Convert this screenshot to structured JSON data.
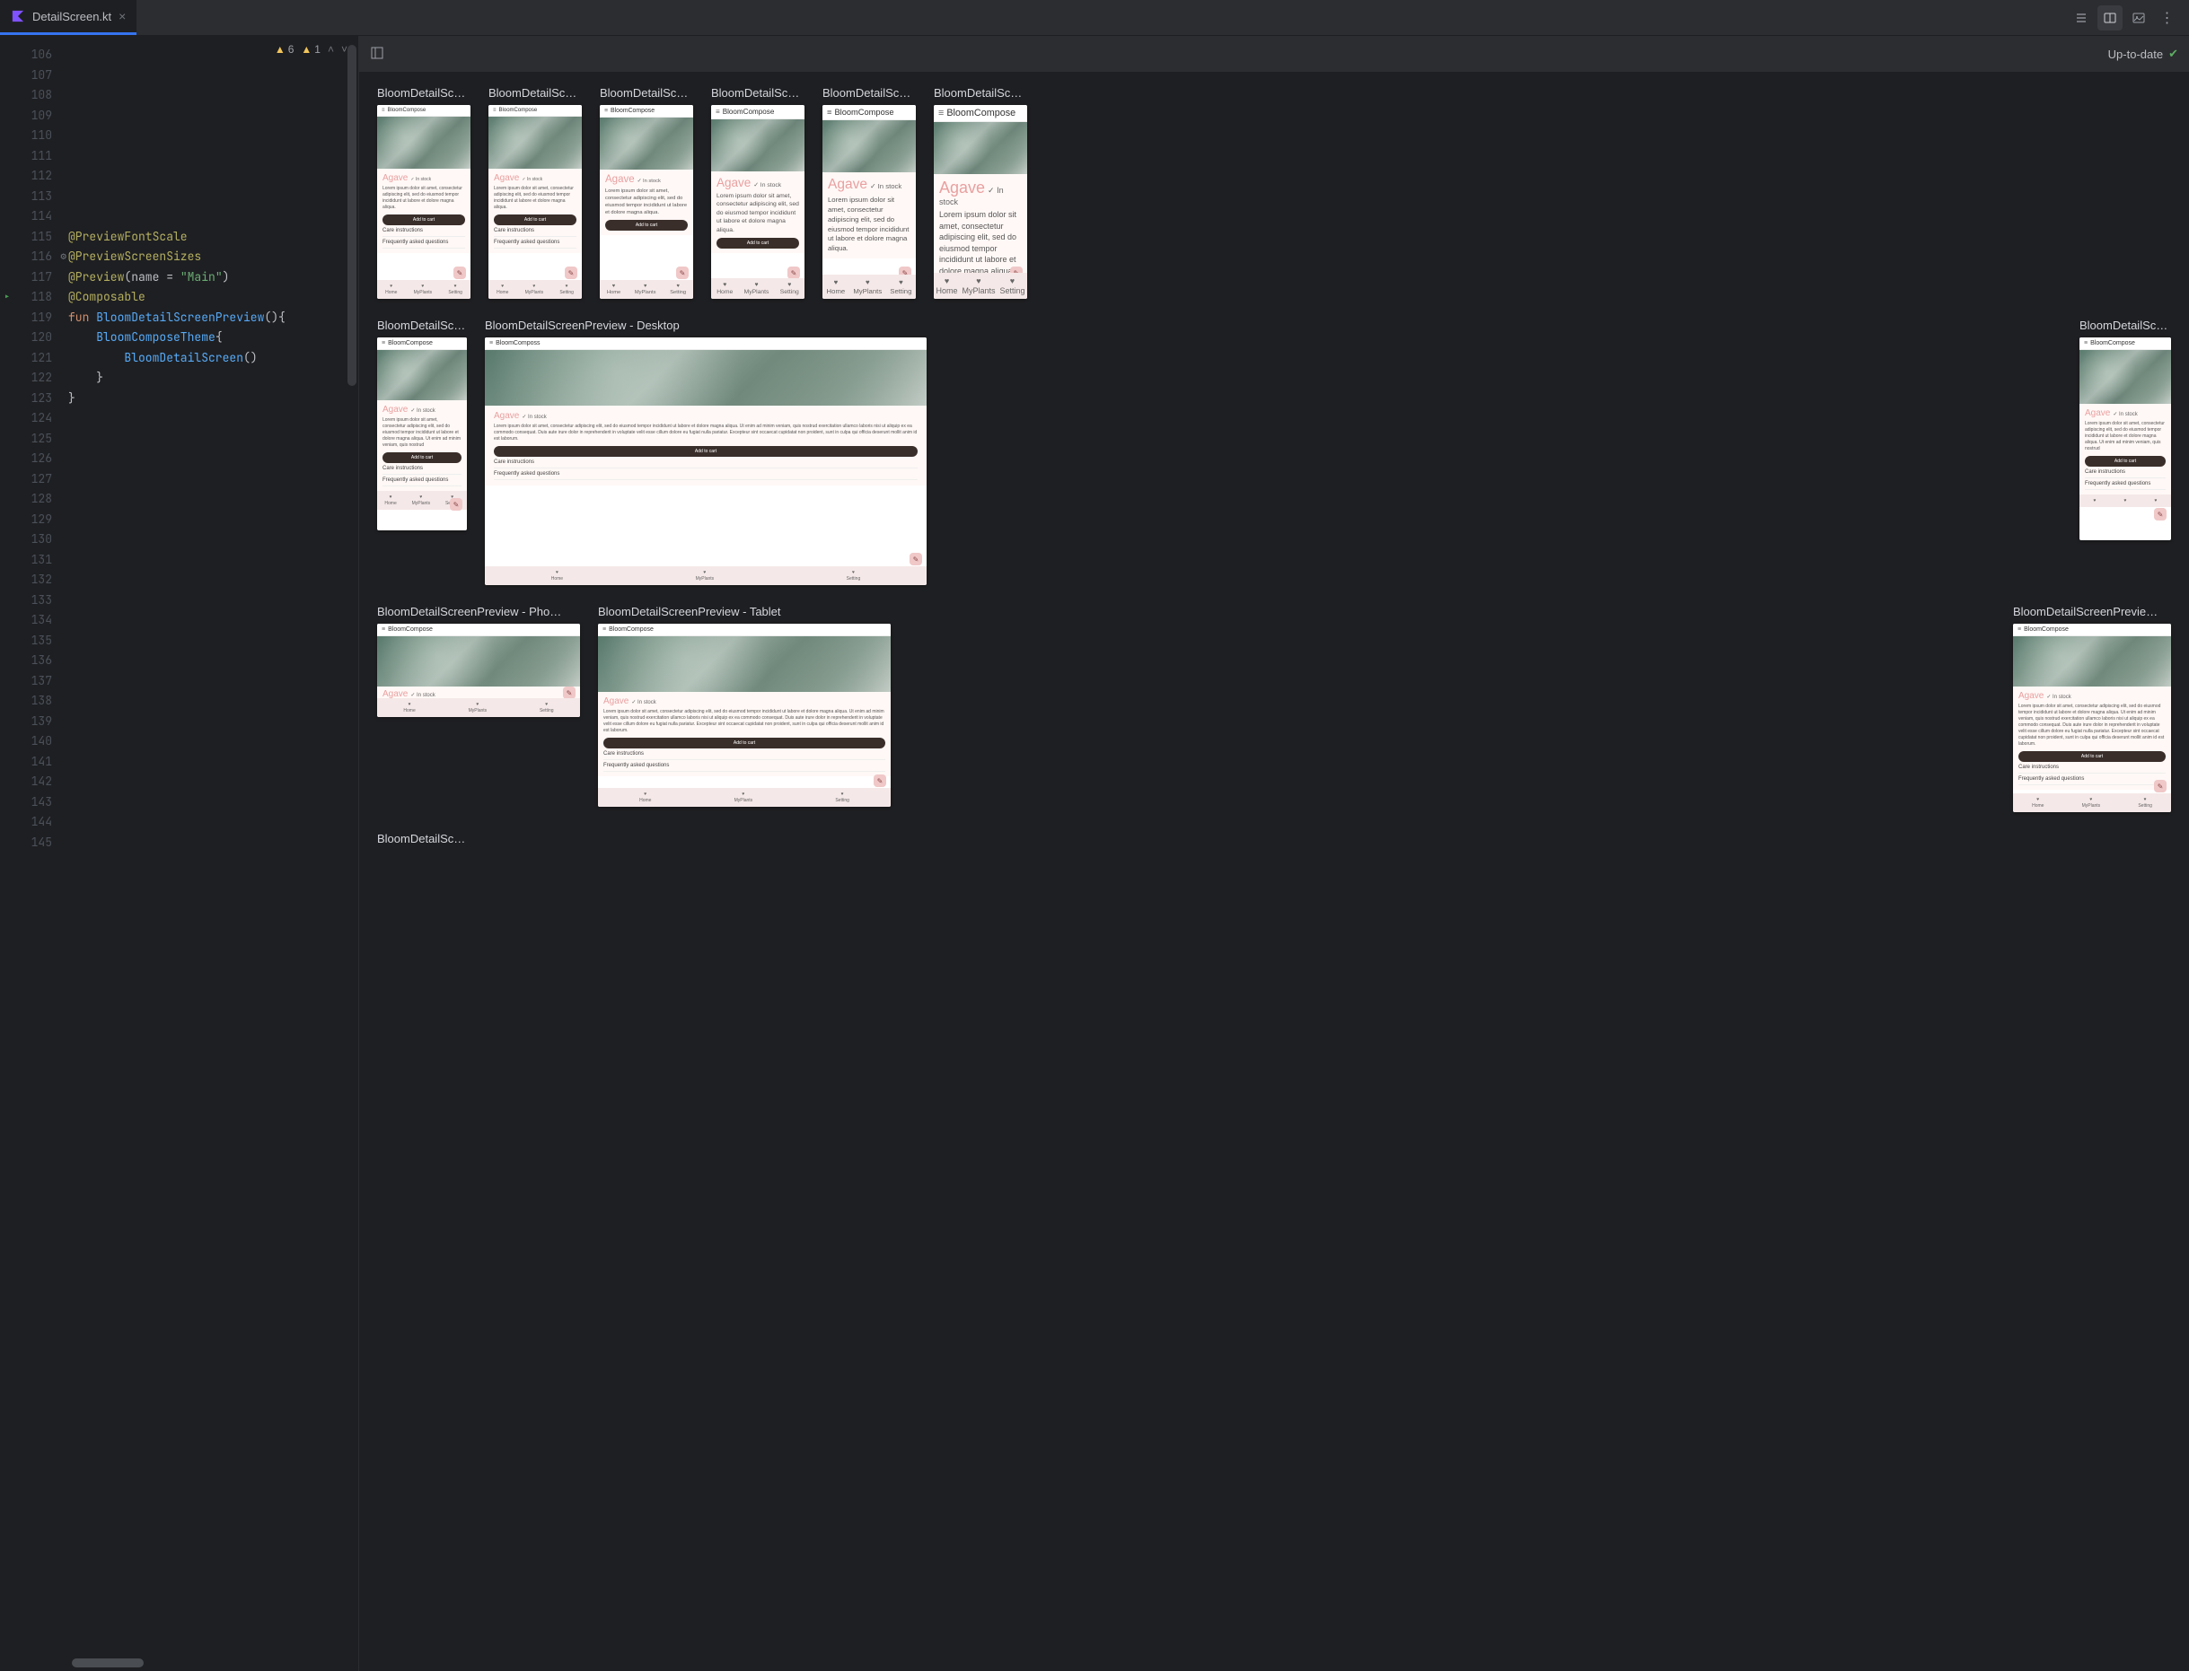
{
  "tab": {
    "filename": "DetailScreen.kt"
  },
  "warnings": {
    "weak": "6",
    "warning": "1"
  },
  "preview_bar": {
    "status": "Up-to-date"
  },
  "gutter": {
    "start": 106,
    "end": 145
  },
  "code": {
    "l114": "@PreviewFontScale",
    "l115": "@PreviewScreenSizes",
    "l116_pre": "@Preview",
    "l116_paren_open": "(name = ",
    "l116_str": "\"Main\"",
    "l116_paren_close": ")",
    "l117": "@Composable",
    "l118_kw": "fun ",
    "l118_fn": "BloomDetailScreenPreview",
    "l118_rest": "(){",
    "l119_call": "BloomComposeTheme",
    "l119_rest": "{",
    "l120_call": "BloomDetailScreen",
    "l120_rest": "()",
    "l121": "    }",
    "l122": "}"
  },
  "previews": {
    "row1_title": "BloomDetailSc…",
    "desktop_title": "BloomDetailScreenPreview - Desktop",
    "phone_title": "BloomDetailScreenPreview - Pho…",
    "tablet_title": "BloomDetailScreenPreview - Tablet",
    "last_title": "BloomDetailScreenPrevie…",
    "bottom_title": "BloomDetailSc…"
  },
  "sample": {
    "app_name": "BloomCompose",
    "app_name_cut": "BloomComposs",
    "plant": "Agave",
    "in_stock": "In stock",
    "in_stock_short": "✓ In stock",
    "lorem_short": "Lorem ipsum dolor sit amet, consectetur adipiscing elit, sed do eiusmod tempor incididunt ut labore et dolore magna aliqua.",
    "lorem_long": "Lorem ipsum dolor sit amet, consectetur adipiscing elit, sed do eiusmod tempor incididunt ut labore et dolore magna aliqua. Ut enim ad minim veniam, quis nostrud",
    "lorem_wide": "Lorem ipsum dolor sit amet, consectetur adipiscing elit, sed do eiusmod tempor incididunt ut labore et dolore magna aliqua. Ut enim ad minim veniam, quis nostrud exercitation ullamco laboris nisi ut aliquip ex ea commodo consequat. Duis aute irure dolor in reprehenderit in voluptate velit esse cillum dolore eu fugiat nulla pariatur. Excepteur sint occaecat cupidatat non proident, sunt in culpa qui officia deserunt mollit anim id est laborum.",
    "add_to_cart": "Add to cart",
    "care": "Care instructions",
    "faq": "Frequently asked questions",
    "nav_home": "Home",
    "nav_plants": "MyPlants",
    "nav_setting": "Setting"
  }
}
